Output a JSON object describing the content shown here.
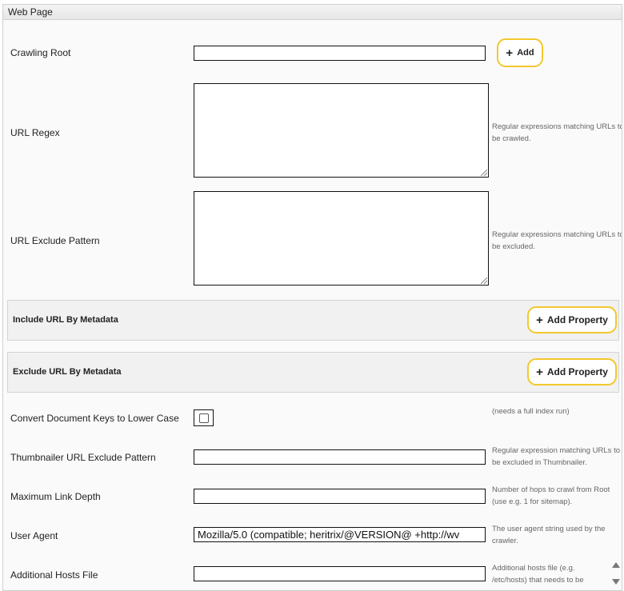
{
  "panel": {
    "title": "Web Page"
  },
  "crawling_root": {
    "label": "Crawling Root",
    "value": "",
    "add_label": "Add"
  },
  "url_regex": {
    "label": "URL Regex",
    "value": "",
    "help": "Regular expressions matching URLs to be crawled."
  },
  "url_exclude": {
    "label": "URL Exclude Pattern",
    "value": "",
    "help": "Regular expressions matching URLs to be excluded."
  },
  "include_meta": {
    "title": "Include URL By Metadata",
    "button": "Add Property"
  },
  "exclude_meta": {
    "title": "Exclude URL By Metadata",
    "button": "Add Property"
  },
  "lowercase": {
    "label": "Convert Document Keys to Lower Case",
    "checked": false,
    "help": "(needs a full index run)"
  },
  "thumb_exclude": {
    "label": "Thumbnailer URL Exclude Pattern",
    "value": "",
    "help": "Regular expression matching URLs to be excluded in Thumbnailer."
  },
  "link_depth": {
    "label": "Maximum Link Depth",
    "value": "",
    "help": "Number of hops to crawl from Root (use e.g. 1 for sitemap)."
  },
  "user_agent": {
    "label": "User Agent",
    "value": "Mozilla/5.0 (compatible; heritrix/@VERSION@ +http://wv",
    "help": "The user agent string used by the crawler."
  },
  "hosts_file": {
    "label": "Additional Hosts File",
    "value": "",
    "help": "Additional hosts file (e.g. /etc/hosts) that needs to be"
  },
  "icons": {
    "add": "plus-icon",
    "scroll_up": "arrow-up-icon",
    "scroll_down": "arrow-down-icon"
  }
}
